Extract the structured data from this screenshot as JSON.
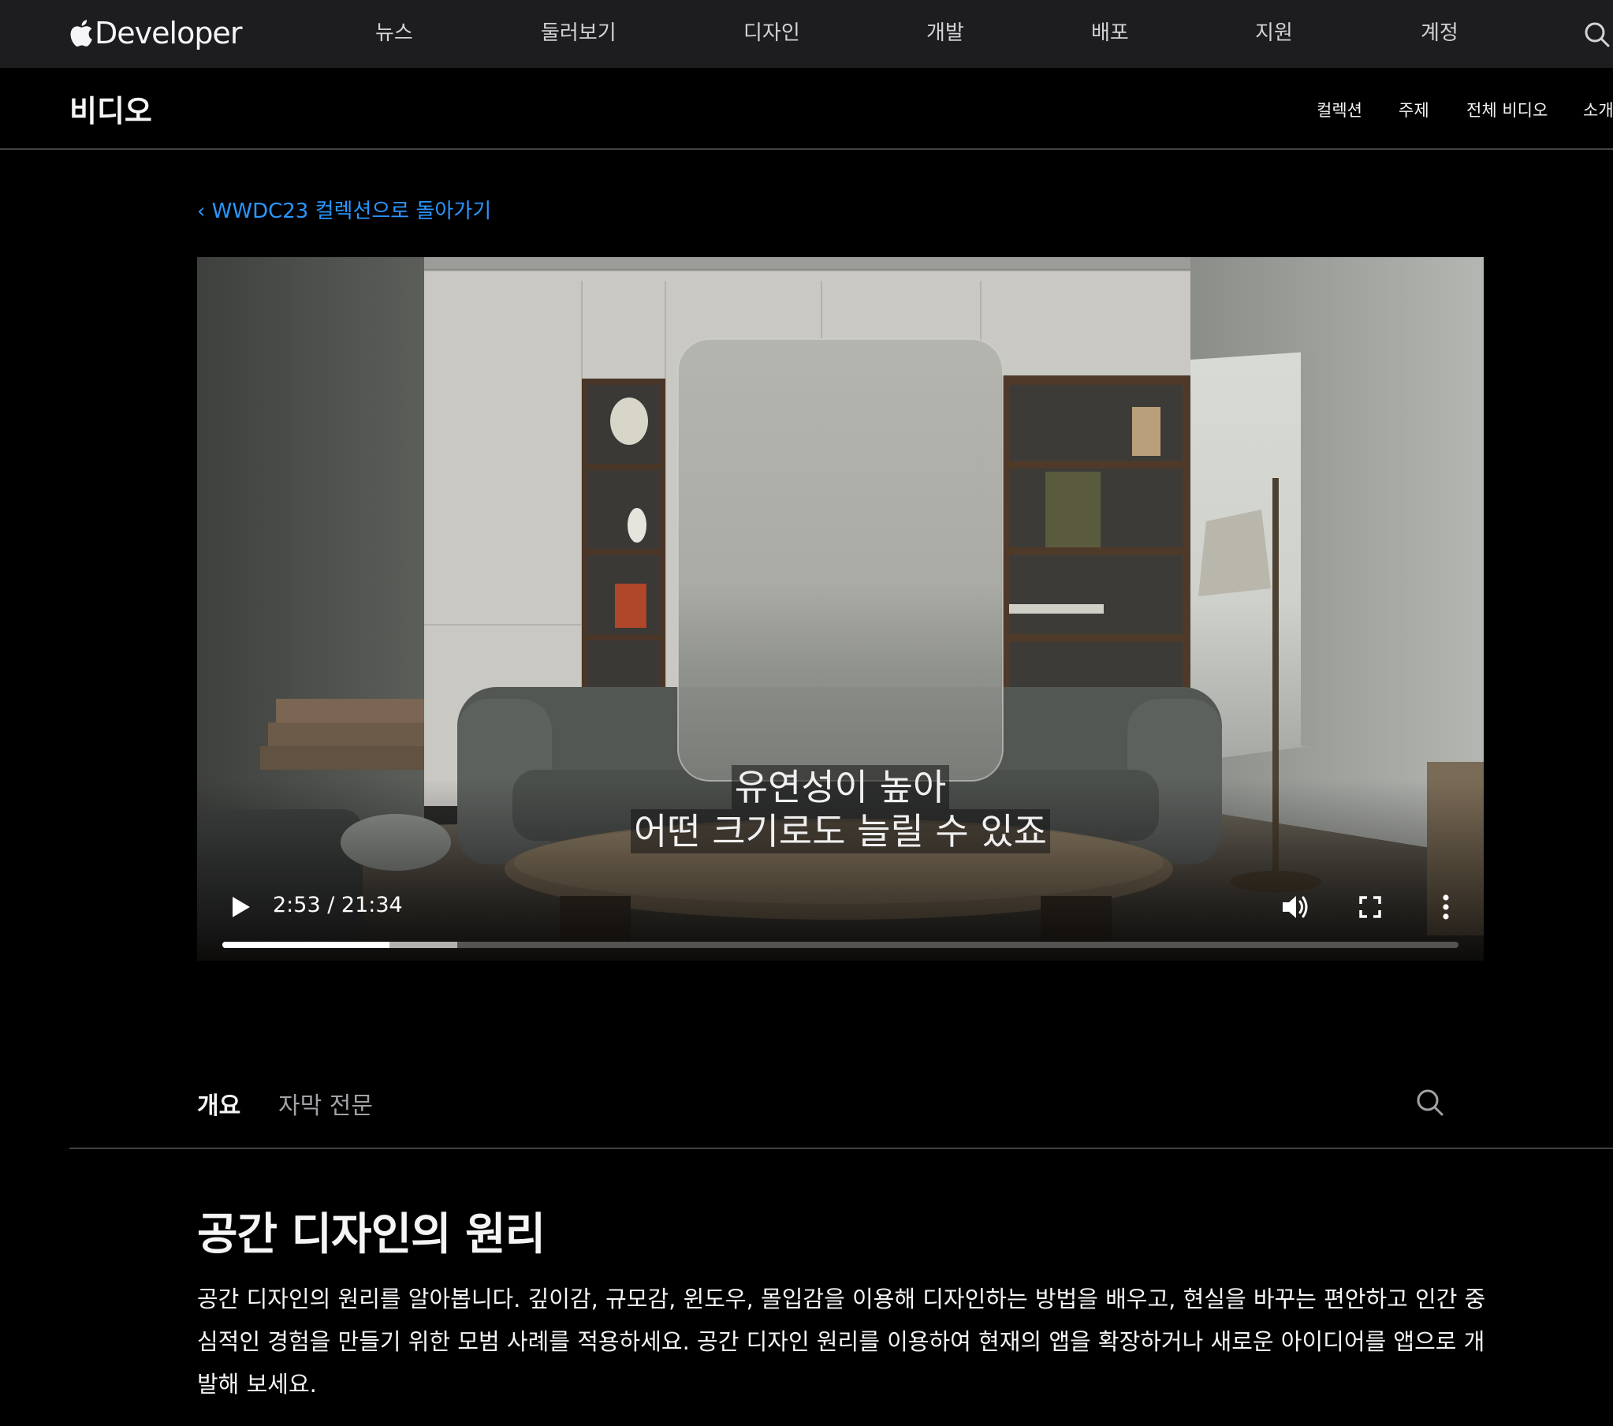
{
  "globalnav": {
    "brand": "Developer",
    "items": [
      "뉴스",
      "둘러보기",
      "디자인",
      "개발",
      "배포",
      "지원",
      "계정"
    ],
    "search_icon": "search-icon"
  },
  "localnav": {
    "title": "비디오",
    "items": [
      "컬렉션",
      "주제",
      "전체 비디오",
      "소개"
    ]
  },
  "backlink": "‹ WWDC23 컬렉션으로 돌아가기",
  "video": {
    "captions": [
      "유연성이 높아",
      "어떤 크기로도 늘릴 수 있죠"
    ],
    "time": "2:53 / 21:34",
    "played_fraction": 0.135,
    "buffered_fraction": 0.19,
    "icons": [
      "play-icon",
      "volume-icon",
      "fullscreen-icon",
      "more-icon"
    ]
  },
  "tabs": {
    "items": [
      "개요",
      "자막 전문"
    ],
    "active": "개요"
  },
  "title": "공간 디자인의 원리",
  "description": "공간 디자인의 원리를 알아봅니다. 깊이감, 규모감, 윈도우, 몰입감을 이용해 디자인하는 방법을 배우고, 현실을 바꾸는 편안하고 인간 중심적인 경험을 만들기 위한 모범 사례를 적용하세요. 공간 디자인 원리를 이용하여 현재의 앱을 확장하거나 새로운 아이디어를 앱으로 개발해 보세요."
}
